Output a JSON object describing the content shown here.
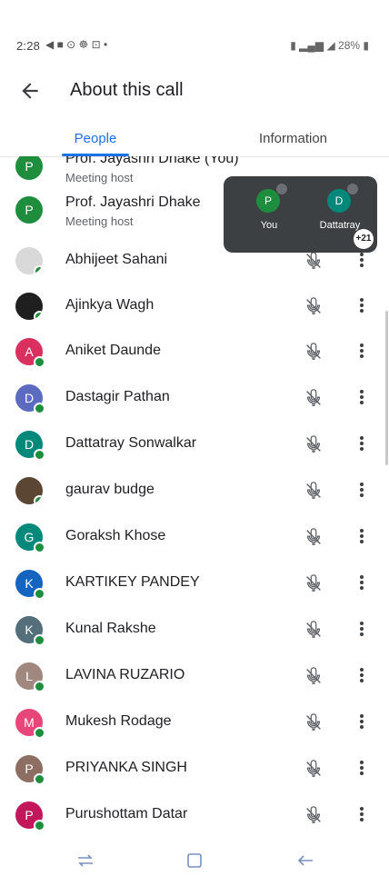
{
  "status_bar": {
    "time": "2:28",
    "left_icons": "◀ ■ ⊙ ☸ ⊡ •",
    "right_text": "28%"
  },
  "app_bar": {
    "title": "About this call",
    "back_icon": "arrow-back-icon"
  },
  "tabs": [
    {
      "label": "People",
      "active": true
    },
    {
      "label": "Information",
      "active": false
    }
  ],
  "participants": [
    {
      "name": "Prof. Jayashri Dhake (You)",
      "subtitle": "Meeting host",
      "initial": "P",
      "color": "#1e8e3e",
      "online": false,
      "partial": true
    },
    {
      "name": "Prof. Jayashri Dhake",
      "subtitle": "Meeting host",
      "initial": "P",
      "color": "#1e8e3e",
      "online": false
    },
    {
      "name": "Abhijeet Sahani",
      "initial": "",
      "color": "#d9d9d9",
      "photo": true,
      "online": true
    },
    {
      "name": "Ajinkya Wagh",
      "initial": "",
      "color": "#1f1f1f",
      "photo": true,
      "online": true
    },
    {
      "name": "Aniket Daunde",
      "initial": "A",
      "color": "#d93060",
      "online": true
    },
    {
      "name": "Dastagir Pathan",
      "initial": "D",
      "color": "#5c6bc0",
      "online": true
    },
    {
      "name": "Dattatray Sonwalkar",
      "initial": "D",
      "color": "#00897b",
      "online": true
    },
    {
      "name": "gaurav budge",
      "initial": "",
      "color": "#5a4632",
      "photo": true,
      "online": true
    },
    {
      "name": "Goraksh Khose",
      "initial": "G",
      "color": "#00897b",
      "online": true
    },
    {
      "name": "KARTIKEY PANDEY",
      "initial": "K",
      "color": "#1565c0",
      "online": true
    },
    {
      "name": "Kunal Rakshe",
      "initial": "K",
      "color": "#546e7a",
      "online": true
    },
    {
      "name": "LAVINA RUZARIO",
      "initial": "L",
      "color": "#a1887f",
      "online": true
    },
    {
      "name": "Mukesh Rodage",
      "initial": "M",
      "color": "#e8457a",
      "online": true
    },
    {
      "name": "PRIYANKA SINGH",
      "initial": "P",
      "color": "#8d6e63",
      "online": true
    },
    {
      "name": "Purushottam Datar",
      "initial": "P",
      "color": "#c2185b",
      "online": true
    }
  ],
  "pip": {
    "tiles": [
      {
        "initial": "P",
        "label": "You",
        "color": "#1e8e3e"
      },
      {
        "initial": "D",
        "label": "Dattatray",
        "color": "#00897b"
      }
    ],
    "more_count": "+21"
  },
  "icons": {
    "mic_off": "mic-off-icon",
    "more": "more-vert-icon"
  },
  "nav_bar": [
    "recent-apps-icon",
    "home-icon",
    "back-icon"
  ]
}
